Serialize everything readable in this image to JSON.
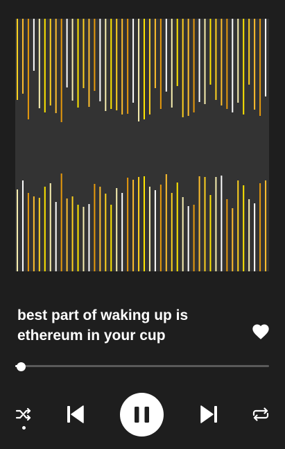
{
  "track": {
    "title": "best part of waking up is ethereum in your cup",
    "liked": true
  },
  "playback": {
    "state": "playing",
    "progress": 0.02,
    "shuffle_enabled": true,
    "repeat_enabled": false
  },
  "visualizer": {
    "palette": [
      "#ffffff",
      "#f8efb0",
      "#ffe600",
      "#ffd21f",
      "#ffbf2e",
      "#e89a0c"
    ]
  },
  "icons": {
    "like": "heart-icon",
    "shuffle": "shuffle-icon",
    "previous": "skip-previous-icon",
    "play_pause": "pause-icon",
    "next": "skip-next-icon",
    "repeat": "repeat-icon"
  },
  "colors": {
    "background": "#1e1e1e",
    "artwork_background": "#333333",
    "icon": "#ffffff",
    "progress_track": "#5a5a5a",
    "progress_fill": "#ffffff"
  }
}
